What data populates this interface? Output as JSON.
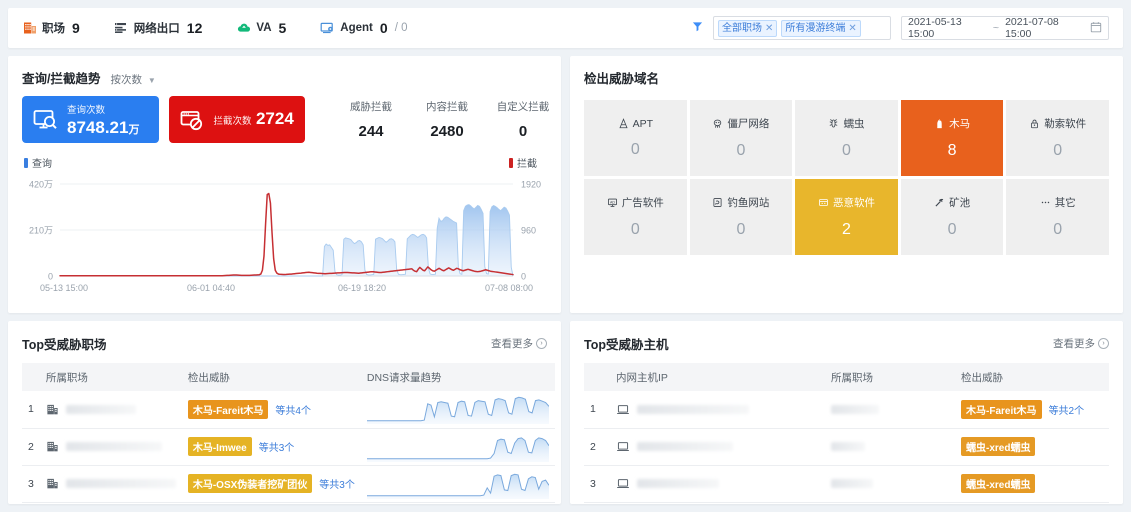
{
  "topbar": {
    "stats": [
      {
        "icon": "building-icon",
        "label": "职场",
        "value": "9",
        "sub": ""
      },
      {
        "icon": "network-egress-icon",
        "label": "网络出口",
        "value": "12",
        "sub": ""
      },
      {
        "icon": "cloud-va-icon",
        "label": "VA",
        "value": "5",
        "sub": ""
      },
      {
        "icon": "agent-monitor-icon",
        "label": "Agent",
        "value": "0",
        "sub": "/ 0"
      }
    ],
    "filter": {
      "icon": "funnel-icon",
      "chips": [
        {
          "label": "全部职场",
          "remove": "✕"
        },
        {
          "label": "所有漫游终端",
          "remove": "✕"
        }
      ],
      "date_start": "2021-05-13 15:00",
      "date_sep": "~",
      "date_end": "2021-07-08 15:00",
      "calendar_icon": "calendar-icon"
    }
  },
  "trend": {
    "title": "查询/拦截趋势",
    "selector": "按次数",
    "selector_caret": "▼",
    "cards": [
      {
        "icon": "monitor-search-icon",
        "label": "查询次数",
        "value": "8748.21",
        "unit": "万",
        "color": "#2a7ef0"
      },
      {
        "icon": "block-screen-icon",
        "label": "拦截次数",
        "value": "2724",
        "unit": "",
        "color": "#dd1111"
      }
    ],
    "sub_metrics": [
      {
        "label": "威胁拦截",
        "value": "244"
      },
      {
        "label": "内容拦截",
        "value": "2480"
      },
      {
        "label": "自定义拦截",
        "value": "0"
      }
    ],
    "legend_left": "查询",
    "legend_left_color": "#3a7fe0",
    "legend_right": "拦截",
    "legend_right_color": "#cc2222"
  },
  "chart_data": {
    "type": "area",
    "title": "查询/拦截趋势",
    "xlabel": "",
    "ylabel": "",
    "grid": true,
    "legend": [
      "查询",
      "拦截"
    ],
    "y_left_ticks": [
      "0",
      "210万",
      "420万"
    ],
    "y_left_range": [
      0,
      4200000
    ],
    "y_right_ticks": [
      "0",
      "960",
      "1920"
    ],
    "y_right_range": [
      0,
      1920
    ],
    "x_ticks": [
      "05-13 15:00",
      "06-01 04:40",
      "06-19 18:20",
      "07-08 08:00"
    ],
    "series": [
      {
        "name": "查询",
        "axis": "left",
        "color": "#aecdf2",
        "values": [
          0,
          0,
          0,
          0,
          0,
          0,
          0,
          0,
          0,
          0,
          0,
          0,
          0,
          0,
          0,
          0,
          0,
          0,
          0,
          0,
          0,
          0,
          0,
          0,
          0,
          0,
          0,
          0,
          0,
          0,
          0,
          0,
          0,
          0,
          0,
          0,
          0,
          0,
          0,
          0,
          0,
          0,
          0,
          0,
          0,
          0,
          0,
          0,
          0,
          0,
          0,
          0,
          0,
          0,
          0,
          0,
          0,
          0,
          0,
          0,
          0,
          0,
          0,
          0,
          0,
          0,
          0,
          0,
          0,
          0,
          0,
          0,
          0,
          0,
          0,
          0,
          0,
          0,
          0,
          0,
          0,
          0,
          0,
          0,
          0,
          0,
          0,
          0,
          0,
          0,
          0,
          0,
          0,
          0,
          0,
          0,
          0,
          0,
          0,
          0,
          0,
          0,
          0,
          0,
          0,
          0,
          0,
          0,
          0,
          0,
          0,
          0,
          0,
          0,
          0,
          0,
          0,
          0,
          0,
          0,
          0,
          0,
          0,
          0,
          0,
          0,
          0,
          0,
          0,
          0,
          0,
          0,
          0,
          0,
          0,
          0,
          0,
          0,
          0,
          0,
          0,
          0,
          0,
          0,
          0,
          0,
          0,
          0,
          0,
          0,
          1350000,
          1460000,
          1400000,
          1420000,
          1300000,
          1180000,
          200000,
          60000,
          40000,
          40000,
          60000,
          1680000,
          1740000,
          1720000,
          1700000,
          1660000,
          1560000,
          1480000,
          1520000,
          1600000,
          1620000,
          1560000,
          1420000,
          260000,
          70000,
          50000,
          50000,
          60000,
          70000,
          1680000,
          1720000,
          1760000,
          1740000,
          1700000,
          1620000,
          1540000,
          1600000,
          1680000,
          1700000,
          1660000,
          1560000,
          300000,
          80000,
          60000,
          60000,
          70000,
          80000,
          1700000,
          1780000,
          1860000,
          1900000,
          1880000,
          1820000,
          1760000,
          1820000,
          1880000,
          1900000,
          1860000,
          1740000,
          360000,
          90000,
          70000,
          70000,
          80000,
          2180000,
          2640000,
          2500000,
          2520000,
          2640000,
          2700000,
          2680000,
          2620000,
          2560000,
          2500000,
          2460000,
          2420000,
          380000,
          100000,
          80000,
          2980000,
          3180000,
          3240000,
          3260000,
          3200000,
          3120000,
          3060000,
          3140000,
          3220000,
          3180000,
          3040000,
          2860000,
          420000,
          110000,
          90000,
          2940000,
          3160000,
          3220000,
          3180000,
          3120000,
          3040000,
          2980000,
          3060000,
          3140000,
          3100000,
          2960000,
          2780000,
          400000,
          0
        ]
      },
      {
        "name": "拦截",
        "axis": "right",
        "color": "#c62f33",
        "values": [
          4,
          4,
          4,
          4,
          4,
          4,
          4,
          4,
          4,
          4,
          4,
          4,
          4,
          4,
          4,
          4,
          4,
          4,
          4,
          4,
          4,
          4,
          4,
          4,
          4,
          4,
          4,
          4,
          4,
          4,
          4,
          4,
          4,
          4,
          4,
          4,
          4,
          4,
          4,
          4,
          4,
          4,
          4,
          4,
          4,
          4,
          4,
          4,
          4,
          4,
          4,
          4,
          4,
          4,
          4,
          4,
          4,
          4,
          4,
          4,
          4,
          4,
          4,
          4,
          4,
          4,
          4,
          4,
          4,
          4,
          4,
          4,
          4,
          4,
          4,
          4,
          4,
          4,
          4,
          4,
          4,
          4,
          4,
          4,
          4,
          4,
          4,
          4,
          4,
          4,
          4,
          4,
          4,
          4,
          4,
          4,
          4,
          4,
          4,
          4,
          6,
          6,
          8,
          10,
          12,
          14,
          16,
          18,
          20,
          22,
          20,
          18,
          16,
          14,
          14,
          12,
          12,
          12,
          14,
          16,
          18,
          20,
          22,
          24,
          26,
          40,
          120,
          420,
          1100,
          1700,
          1720,
          1520,
          900,
          360,
          120,
          60,
          40,
          36,
          34,
          32,
          30,
          34,
          36,
          38,
          40,
          44,
          48,
          52,
          56,
          58,
          60,
          64,
          68,
          72,
          76,
          78,
          74,
          70,
          66,
          62,
          58,
          56,
          54,
          52,
          50,
          48,
          50,
          52,
          54,
          56,
          58,
          60,
          62,
          64,
          66,
          68,
          70,
          72,
          74,
          72,
          70,
          68,
          66,
          64,
          62,
          60,
          58,
          62,
          66,
          70,
          74,
          78,
          82,
          86,
          90,
          88,
          84,
          80,
          76,
          72,
          74,
          78,
          82,
          86,
          90,
          94,
          98,
          102,
          106,
          110,
          114,
          118,
          122,
          126,
          130,
          134,
          138,
          142,
          146,
          150,
          120,
          100,
          90,
          140,
          180,
          150,
          120,
          110,
          150,
          190,
          160,
          130,
          110,
          100,
          120,
          140,
          160,
          140,
          120,
          110,
          130,
          150,
          170,
          150,
          130,
          120,
          140,
          160,
          150,
          130,
          120,
          110,
          120,
          130,
          140,
          130,
          120,
          110,
          100,
          95,
          90,
          95,
          100,
          110,
          120,
          130,
          120,
          110,
          100,
          95,
          90,
          85,
          80,
          75,
          70,
          65,
          60,
          55,
          50,
          45,
          40,
          35,
          30
        ]
      }
    ]
  },
  "threat_domains": {
    "title": "检出威胁域名",
    "cells": [
      {
        "icon": "apt-icon",
        "label": "APT",
        "value": "0",
        "state": "normal"
      },
      {
        "icon": "botnet-icon",
        "label": "僵尸网络",
        "value": "0",
        "state": "normal"
      },
      {
        "icon": "worm-icon",
        "label": "蠕虫",
        "value": "0",
        "state": "normal"
      },
      {
        "icon": "trojan-icon",
        "label": "木马",
        "value": "8",
        "state": "hot-orange"
      },
      {
        "icon": "ransomware-icon",
        "label": "勒索软件",
        "value": "0",
        "state": "normal"
      },
      {
        "icon": "adware-icon",
        "label": "广告软件",
        "value": "0",
        "state": "normal"
      },
      {
        "icon": "phishing-icon",
        "label": "钓鱼网站",
        "value": "0",
        "state": "normal"
      },
      {
        "icon": "malware-icon",
        "label": "恶意软件",
        "value": "2",
        "state": "hot-yellow"
      },
      {
        "icon": "mining-pool-icon",
        "label": "矿池",
        "value": "0",
        "state": "normal"
      },
      {
        "icon": "other-icon",
        "label": "其它",
        "value": "0",
        "state": "normal"
      }
    ]
  },
  "top_sites": {
    "title": "Top受威胁职场",
    "more": "查看更多",
    "more_icon": "chevron-right-circle-icon",
    "columns": [
      "",
      "所属职场",
      "检出威胁",
      "DNS请求量趋势"
    ],
    "rows": [
      {
        "index": "1",
        "site_icon": "building-icon",
        "site": "",
        "tag": "木马-Fareit木马",
        "tag_color": "orange",
        "extra": "等共4个",
        "spark": "late-dense"
      },
      {
        "index": "2",
        "site_icon": "building-icon",
        "site": "",
        "tag": "木马-Imwee",
        "tag_color": "gold",
        "extra": "等共3个",
        "spark": "tail-3"
      },
      {
        "index": "3",
        "site_icon": "building-icon",
        "site": "",
        "tag": "木马-OSX伪装者挖矿团伙",
        "tag_color": "gold",
        "extra": "等共3个",
        "spark": "tail-4"
      }
    ]
  },
  "top_hosts": {
    "title": "Top受威胁主机",
    "more": "查看更多",
    "more_icon": "chevron-right-circle-icon",
    "columns": [
      "",
      "内网主机IP",
      "所属职场",
      "检出威胁"
    ],
    "rows": [
      {
        "index": "1",
        "host_icon": "laptop-icon",
        "ip": "",
        "site": "",
        "tag": "木马-Fareit木马",
        "tag_color": "orange",
        "extra": "等共2个"
      },
      {
        "index": "2",
        "host_icon": "laptop-icon",
        "ip": "",
        "site": "",
        "tag": "蠕虫-xred蠕虫",
        "tag_color": "amber",
        "extra": ""
      },
      {
        "index": "3",
        "host_icon": "laptop-icon",
        "ip": "",
        "site": "",
        "tag": "蠕虫-xred蠕虫",
        "tag_color": "amber",
        "extra": ""
      }
    ]
  }
}
